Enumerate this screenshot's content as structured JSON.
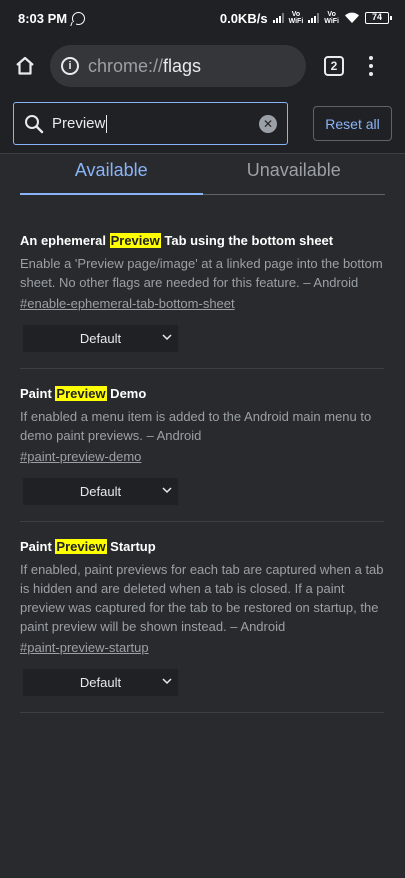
{
  "status_bar": {
    "time": "8:03 PM",
    "net_speed": "0.0KB/s",
    "vowifi_1": "Vo\nWiFi",
    "vowifi_2": "Vo\nWiFi",
    "battery": "74"
  },
  "toolbar": {
    "url_scheme": "chrome://",
    "url_host": "flags",
    "tab_count": "2"
  },
  "search": {
    "value": "Preview",
    "reset_label": "Reset all"
  },
  "tabs": [
    {
      "label": "Available",
      "active": true
    },
    {
      "label": "Unavailable",
      "active": false
    }
  ],
  "flags": [
    {
      "title_pre": "An ephemeral ",
      "title_hl": "Preview",
      "title_post": " Tab using the bottom sheet",
      "description": "Enable a 'Preview page/image' at a linked page into the bottom sheet. No other flags are needed for this feature. – Android",
      "link": "#enable-ephemeral-tab-bottom-sheet",
      "select_value": "Default"
    },
    {
      "title_pre": "Paint ",
      "title_hl": "Preview",
      "title_post": " Demo",
      "description": "If enabled a menu item is added to the Android main menu to demo paint previews. – Android",
      "link": "#paint-preview-demo",
      "select_value": "Default"
    },
    {
      "title_pre": "Paint ",
      "title_hl": "Preview",
      "title_post": " Startup",
      "description": "If enabled, paint previews for each tab are captured when a tab is hidden and are deleted when a tab is closed. If a paint preview was captured for the tab to be restored on startup, the paint preview will be shown instead. – Android",
      "link": "#paint-preview-startup",
      "select_value": "Default"
    }
  ],
  "colors": {
    "background": "#292a2d",
    "toolbar": "#202124",
    "accent": "#8ab4f8",
    "highlight": "#ffff00"
  }
}
